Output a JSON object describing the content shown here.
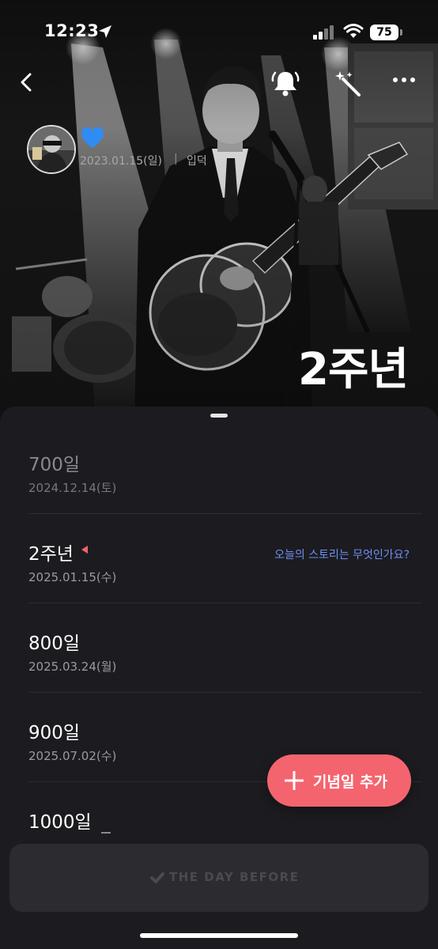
{
  "status_bar": {
    "time": "12:23",
    "battery": "75"
  },
  "hero": {
    "date": "2023.01.15(일)",
    "separator": "|",
    "status": "입덕",
    "anniversary_title": "2주년"
  },
  "anniversaries": [
    {
      "title": "700일",
      "date": "2024.12.14(토)",
      "past": true
    },
    {
      "title": "2주년",
      "date": "2025.01.15(수)",
      "today": true,
      "prompt": "오늘의 스토리는 무엇인가요?"
    },
    {
      "title": "800일",
      "date": "2025.03.24(월)"
    },
    {
      "title": "900일",
      "date": "2025.07.02(수)"
    },
    {
      "title": "1000일",
      "date": ""
    }
  ],
  "fab": {
    "label": "기념일 추가"
  },
  "bottom_bar": {
    "logo_text": "THE DAY BEFORE"
  },
  "colors": {
    "accent": "#f4646e",
    "link": "#6f8ff2",
    "background": "#1c1c20"
  }
}
